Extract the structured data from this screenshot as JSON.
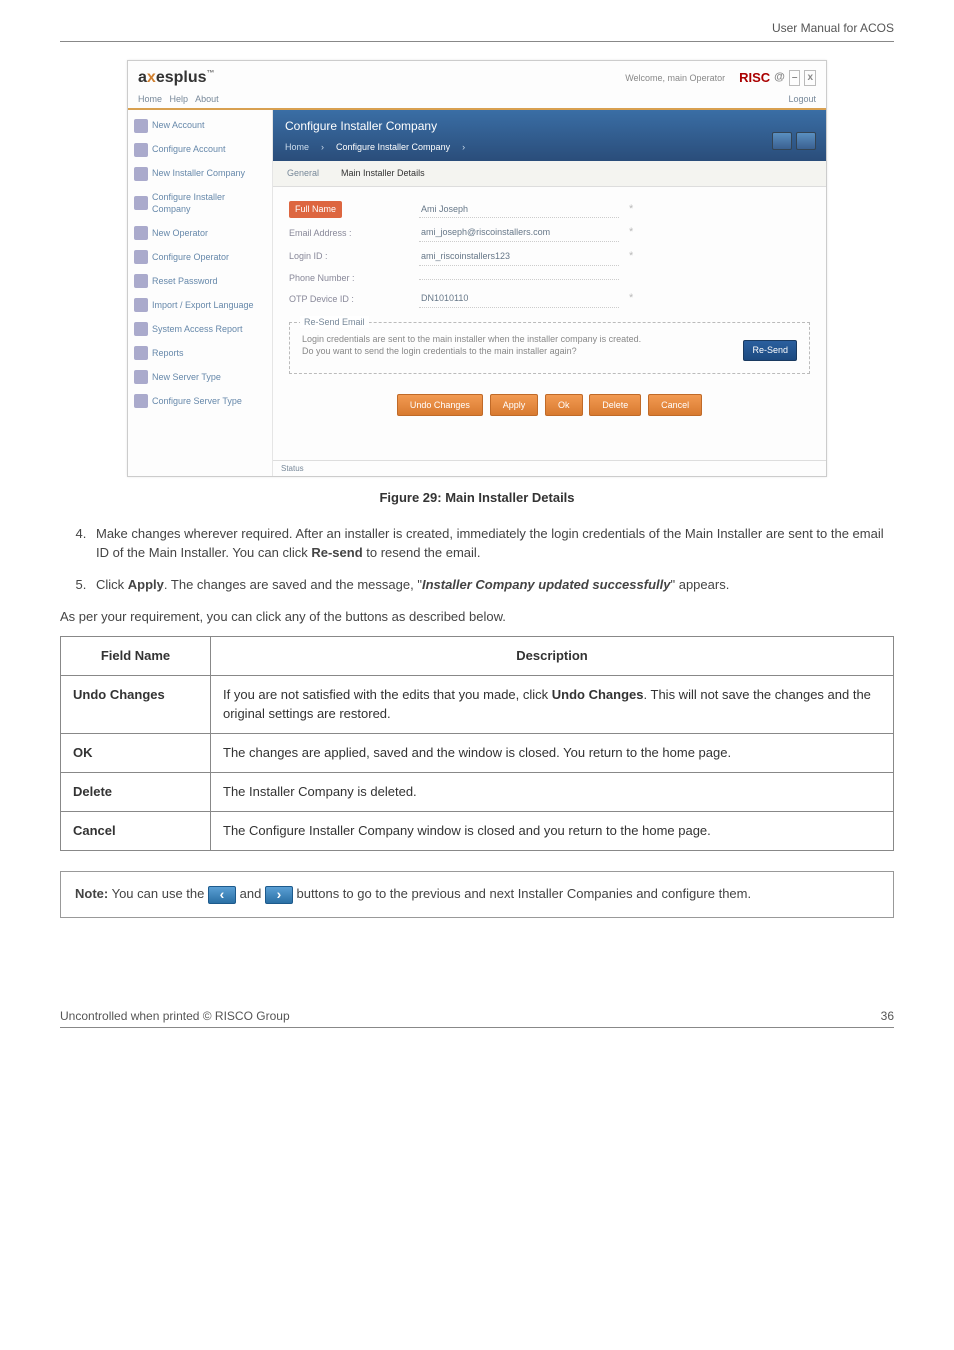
{
  "doc": {
    "header": "User Manual for ACOS",
    "footer_left": "Uncontrolled when printed © RISCO Group",
    "footer_right": "36"
  },
  "screenshot": {
    "brand_prefix": "a",
    "brand_mid": "x",
    "brand_suffix": "esplus",
    "brand_tm": "™",
    "welcome": "Welcome, main Operator",
    "risco": "RISC",
    "risco_at": "@",
    "min": "–",
    "cls": "x",
    "menu": {
      "home": "Home",
      "help": "Help",
      "about": "About",
      "logout": "Logout"
    },
    "side": {
      "new_account": "New Account",
      "configure_account": "Configure Account",
      "new_installer": "New Installer Company",
      "configure_installer": "Configure Installer Company",
      "new_operator": "New Operator",
      "configure_operator": "Configure Operator",
      "reset_password": "Reset Password",
      "import_export": "Import / Export Language",
      "system_access": "System Access Report",
      "reports": "Reports",
      "new_server": "New Server Type",
      "configure_server": "Configure Server Type"
    },
    "panel_title": "Configure Installer Company",
    "panel_sub_home": "Home",
    "panel_sub_cfg": "Configure Installer Company",
    "tabs": {
      "general": "General",
      "main": "Main Installer Details"
    },
    "form": {
      "full_name_lbl": "Full Name",
      "full_name_val": "Ami Joseph",
      "email_lbl": "Email Address :",
      "email_val": "ami_joseph@riscoinstallers.com",
      "login_lbl": "Login ID :",
      "login_val": "ami_riscoinstallers123",
      "phone_lbl": "Phone Number :",
      "phone_val": "",
      "otp_lbl": "OTP Device ID :",
      "otp_val": "DN1010110",
      "ast": "*"
    },
    "resend": {
      "legend": "Re-Send Email",
      "line1": "Login credentials are sent to the main installer when the installer company is created.",
      "line2": "Do you want to send the login credentials to the main installer again?",
      "btn": "Re-Send"
    },
    "actions": {
      "undo": "Undo Changes",
      "apply": "Apply",
      "ok": "Ok",
      "del": "Delete",
      "cancel": "Cancel"
    },
    "status": "Status"
  },
  "figcap": "Figure 29: Main Installer Details",
  "steps": {
    "s4_pre": "Make changes wherever required. After an installer is created, immediately the login credentials of the Main Installer are sent to the email ID of the Main Installer. You can click ",
    "s4_bold": "Re-send",
    "s4_post": " to resend the email.",
    "s5_a": "Click ",
    "s5_b": "Apply",
    "s5_c": ". The changes are saved and the message, \"",
    "s5_d": "Installer Company updated successfully",
    "s5_e": "\" appears."
  },
  "intro": "As per your requirement, you can click any of the buttons as described below.",
  "table": {
    "h1": "Field Name",
    "h2": "Description",
    "r1n": "Undo Changes",
    "r1d_a": "If you are not satisfied with the edits that you made, click ",
    "r1d_b": "Undo Changes",
    "r1d_c": ". This will not save the changes and the original settings are restored.",
    "r2n": "OK",
    "r2d": "The changes are applied, saved and the window is closed. You return to the home page.",
    "r3n": "Delete",
    "r3d": "The Installer Company is deleted.",
    "r4n": "Cancel",
    "r4d": "The Configure Installer Company window is closed and you return to the home page."
  },
  "note": {
    "lead": "Note:",
    "a": " You can use the ",
    "b": " and ",
    "c": " buttons to go to the previous and next Installer Companies and configure them.",
    "prev_glyph": "‹",
    "next_glyph": "›"
  }
}
